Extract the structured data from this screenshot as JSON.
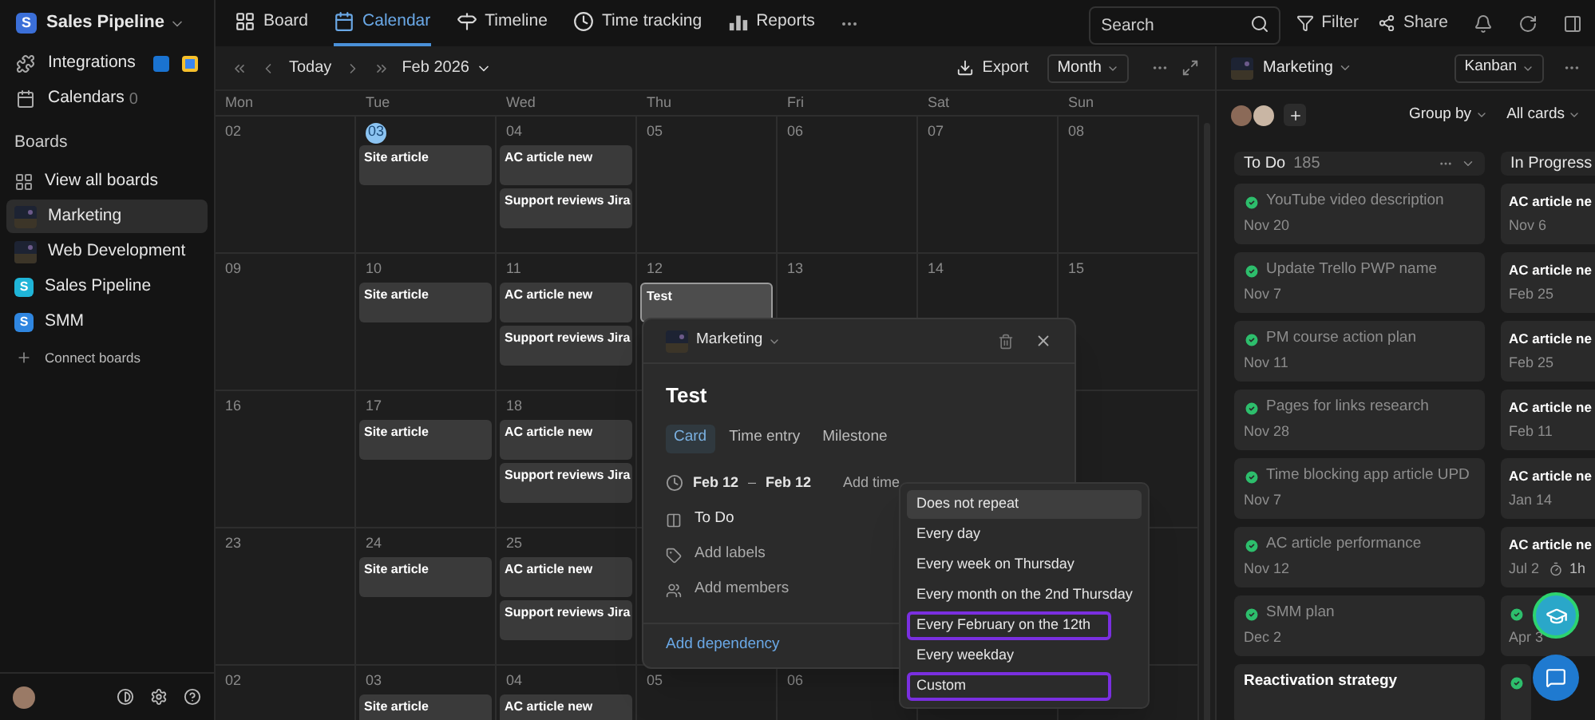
{
  "workspace": {
    "badge": "S",
    "name": "Sales Pipeline"
  },
  "sidebar": {
    "integrations": "Integrations",
    "calendars": "Calendars",
    "calendars_count": "0",
    "boards_heading": "Boards",
    "boards": [
      {
        "label": "View all boards",
        "kind": "all",
        "selected": false
      },
      {
        "label": "Marketing",
        "kind": "image",
        "selected": true
      },
      {
        "label": "Web Development",
        "kind": "image",
        "selected": false
      },
      {
        "label": "Sales Pipeline",
        "kind": "letter",
        "badge": "S",
        "color": "#1fb5d8",
        "selected": false
      },
      {
        "label": "SMM",
        "kind": "letter",
        "badge": "S",
        "color": "#2f86e0",
        "selected": false
      }
    ],
    "connect": "Connect boards"
  },
  "nav": {
    "tabs": [
      {
        "label": "Board",
        "kind": "board",
        "selected": false
      },
      {
        "label": "Calendar",
        "kind": "calendar",
        "selected": true
      },
      {
        "label": "Timeline",
        "kind": "timeline",
        "selected": false
      },
      {
        "label": "Time tracking",
        "kind": "time",
        "selected": false
      },
      {
        "label": "Reports",
        "kind": "reports",
        "selected": false
      }
    ],
    "search": {
      "placeholder": "Search"
    },
    "filter": "Filter",
    "share": "Share"
  },
  "calendar": {
    "today": "Today",
    "month": "Feb 2026",
    "export": "Export",
    "view": "Month",
    "weekdays": [
      "Mon",
      "Tue",
      "Wed",
      "Thu",
      "Fri",
      "Sat",
      "Sun"
    ],
    "weeks": [
      [
        {
          "date": "02",
          "today": false
        },
        {
          "date": "03",
          "today": true,
          "events": [
            {
              "title": "Site article",
              "selected": false
            }
          ]
        },
        {
          "date": "04",
          "today": false,
          "events": [
            {
              "title": "AC article new",
              "selected": false
            },
            {
              "title": "Support reviews Jira",
              "selected": false
            }
          ]
        },
        {
          "date": "05",
          "today": false
        },
        {
          "date": "06",
          "today": false
        },
        {
          "date": "07",
          "today": false
        },
        {
          "date": "08",
          "today": false
        }
      ],
      [
        {
          "date": "09",
          "today": false
        },
        {
          "date": "10",
          "today": false,
          "events": [
            {
              "title": "Site article",
              "selected": false
            }
          ]
        },
        {
          "date": "11",
          "today": false,
          "events": [
            {
              "title": "AC article new",
              "selected": false
            },
            {
              "title": "Support reviews Jira",
              "selected": false
            }
          ]
        },
        {
          "date": "12",
          "today": false,
          "events": [
            {
              "title": "Test",
              "selected": true
            }
          ]
        },
        {
          "date": "13",
          "today": false
        },
        {
          "date": "14",
          "today": false
        },
        {
          "date": "15",
          "today": false
        }
      ],
      [
        {
          "date": "16",
          "today": false
        },
        {
          "date": "17",
          "today": false,
          "events": [
            {
              "title": "Site article",
              "selected": false
            }
          ]
        },
        {
          "date": "18",
          "today": false,
          "events": [
            {
              "title": "AC article new",
              "selected": false
            },
            {
              "title": "Support reviews Jira",
              "selected": false
            }
          ]
        }
      ],
      [
        {
          "date": "23",
          "today": false
        },
        {
          "date": "24",
          "today": false,
          "events": [
            {
              "title": "Site article",
              "selected": false
            }
          ]
        },
        {
          "date": "25",
          "today": false,
          "events": [
            {
              "title": "AC article new",
              "selected": false
            },
            {
              "title": "Support reviews Jira",
              "selected": false
            }
          ]
        }
      ],
      [
        {
          "date": "02",
          "today": false
        },
        {
          "date": "03",
          "today": false,
          "events": [
            {
              "title": "Site article",
              "selected": false
            }
          ]
        },
        {
          "date": "04",
          "today": false,
          "events": [
            {
              "title": "AC article new",
              "selected": false
            }
          ]
        },
        {
          "date": "05",
          "today": false
        },
        {
          "date": "06",
          "today": false
        }
      ]
    ]
  },
  "card_popup": {
    "board": "Marketing",
    "title": "Test",
    "tabs": [
      {
        "label": "Card",
        "selected": true
      },
      {
        "label": "Time entry",
        "selected": false
      },
      {
        "label": "Milestone",
        "selected": false
      }
    ],
    "start": "Feb 12",
    "dash": "–",
    "end": "Feb 12",
    "add_time": "Add time",
    "status": "To Do",
    "add_labels": "Add labels",
    "add_members": "Add members",
    "add_dependency": "Add dependency"
  },
  "repeat_menu": {
    "items": [
      {
        "label": "Does not repeat",
        "selected": true,
        "outlined": false
      },
      {
        "label": "Every day",
        "selected": false,
        "outlined": false
      },
      {
        "label": "Every week on Thursday",
        "selected": false,
        "outlined": false
      },
      {
        "label": "Every month on the 2nd Thursday",
        "selected": false,
        "outlined": false
      },
      {
        "label": "Every February on the 12th",
        "selected": false,
        "outlined": true
      },
      {
        "label": "Every weekday",
        "selected": false,
        "outlined": false
      },
      {
        "label": "Custom",
        "selected": false,
        "outlined": true
      }
    ]
  },
  "kanban": {
    "board": "Marketing",
    "view": "Kanban",
    "group_by": "Group by",
    "filter": "All cards",
    "columns": [
      {
        "title": "To Do",
        "count": "185",
        "cards": [
          {
            "title": "YouTube video description",
            "date": "Nov 20",
            "done": true
          },
          {
            "title": "Update Trello PWP name",
            "date": "Nov 7",
            "done": true
          },
          {
            "title": "PM course action plan",
            "date": "Nov 11",
            "done": true
          },
          {
            "title": "Pages for links research",
            "date": "Nov 28",
            "done": true
          },
          {
            "title": "Time blocking app article UPD",
            "date": "Nov 7",
            "done": true
          },
          {
            "title": "AC article performance",
            "date": "Nov 12",
            "done": true
          },
          {
            "title": "SMM plan",
            "date": "Dec 2",
            "done": true
          },
          {
            "title": "Reactivation strategy",
            "done": false
          }
        ]
      },
      {
        "title": "In Progress",
        "cards": [
          {
            "title": "AC article ne",
            "date": "Nov 6",
            "done": false
          },
          {
            "title": "AC article ne",
            "date": "Feb 25",
            "done": false
          },
          {
            "title": "AC article ne",
            "date": "Feb 25",
            "done": false
          },
          {
            "title": "AC article ne",
            "date": "Feb 11",
            "done": false
          },
          {
            "title": "AC article ne",
            "date": "Jan 14",
            "done": false
          },
          {
            "title": "AC article ne",
            "date": "Jul 2",
            "estimate": "1h",
            "done": false
          },
          {
            "date": "Apr 3",
            "done": true
          },
          {
            "done": true
          }
        ]
      }
    ]
  }
}
